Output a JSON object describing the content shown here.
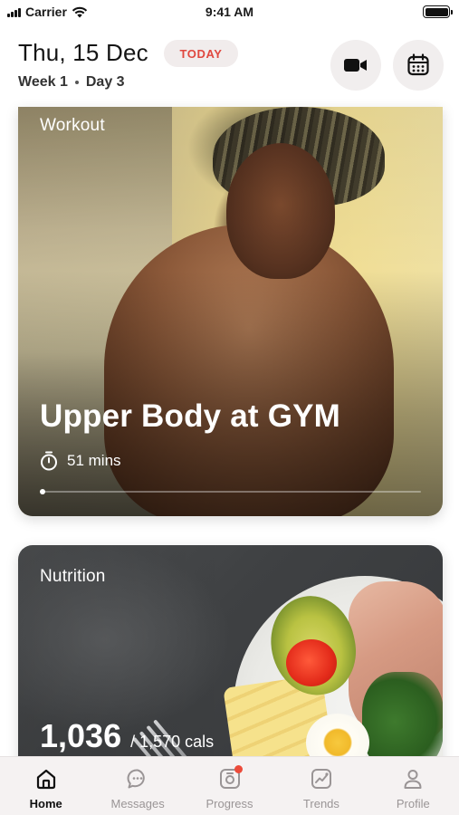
{
  "status_bar": {
    "carrier": "Carrier",
    "time": "9:41 AM"
  },
  "header": {
    "date": "Thu, 15 Dec",
    "badge": "TODAY",
    "week": "Week 1",
    "day": "Day 3",
    "icons": [
      "video-camera-icon",
      "calendar-icon"
    ]
  },
  "workout": {
    "label": "Workout",
    "title": "Upper Body at GYM",
    "duration": "51 mins",
    "progress": 0.0
  },
  "nutrition": {
    "label": "Nutrition",
    "calories": "1,036",
    "goal": "/ 1,570 cals"
  },
  "tabs": [
    {
      "label": "Home",
      "icon": "home-icon",
      "active": true
    },
    {
      "label": "Messages",
      "icon": "chat-icon",
      "active": false
    },
    {
      "label": "Progress",
      "icon": "progress-camera-icon",
      "active": false,
      "badge": true
    },
    {
      "label": "Trends",
      "icon": "trends-chart-icon",
      "active": false
    },
    {
      "label": "Profile",
      "icon": "profile-icon",
      "active": false
    }
  ],
  "colors": {
    "accent": "#e0483f",
    "badge_bg": "#f1ecec",
    "tab_inactive": "#9a9596",
    "tab_active": "#111111"
  }
}
